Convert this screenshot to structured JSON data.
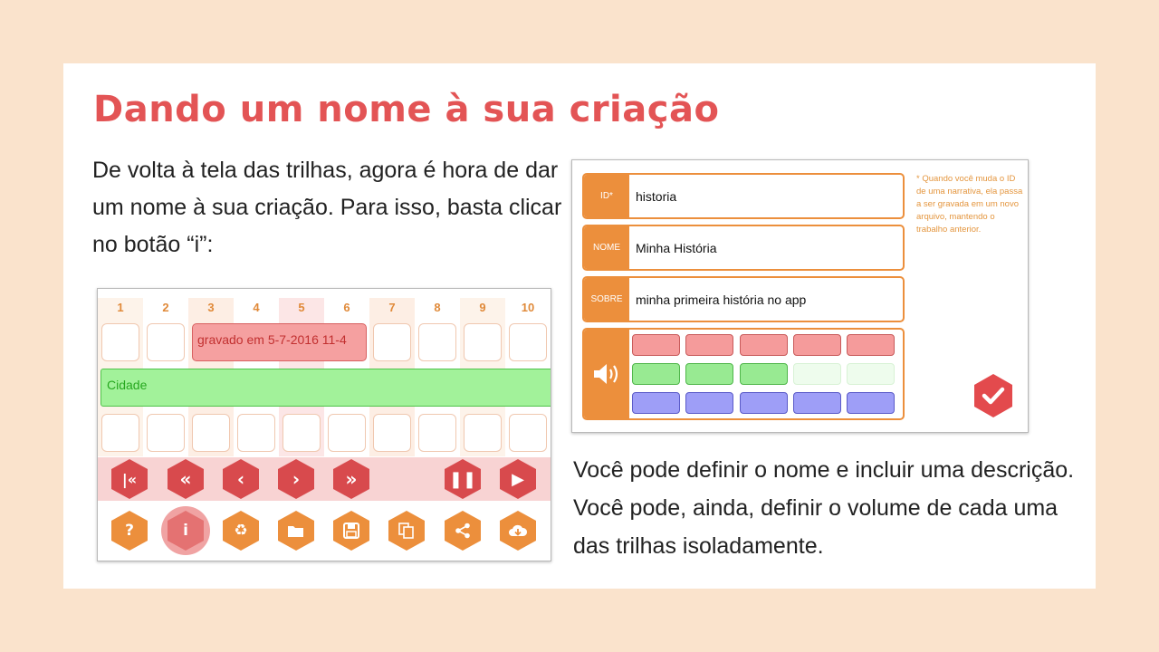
{
  "slide": {
    "title": "Dando um nome à sua criação",
    "paragraph_1": "De volta à tela das trilhas, agora é hora de dar um nome à sua criação. Para isso, basta clicar no botão “i”:",
    "paragraph_2": "Você pode definir o nome e incluir uma descrição. Você pode, ainda, definir o volume de cada uma das trilhas isoladamente."
  },
  "tracks_screen": {
    "column_numbers": [
      "1",
      "2",
      "3",
      "4",
      "5",
      "6",
      "7",
      "8",
      "9",
      "10"
    ],
    "recorded_clip": "gravado em 5-7-2016 11-4",
    "city_clip": "Cidade",
    "nav_icons": [
      "skip-to-start-icon",
      "rewind-icon",
      "previous-icon",
      "next-icon",
      "fast-forward-icon",
      "pause-icon",
      "play-icon"
    ],
    "tool_icons": [
      "help-icon",
      "info-icon",
      "recycle-icon",
      "open-folder-icon",
      "save-icon",
      "copy-icon",
      "share-icon",
      "download-cloud-icon"
    ],
    "colors": {
      "red_button": "#d84a4d",
      "orange_button": "#ec8f3c",
      "highlight": "#f0a3a3"
    }
  },
  "info_screen": {
    "fields": [
      {
        "label": "ID*",
        "value": "historia"
      },
      {
        "label": "NOME",
        "value": "Minha História"
      },
      {
        "label": "SOBRE",
        "value": "minha primeira história no app"
      }
    ],
    "note": "* Quando você muda o ID de uma narrativa, ela passa a ser gravada em um novo arquivo, mantendo o trabalho anterior.",
    "volume_icon": "speaker-volume-icon",
    "confirm_icon": "checkmark-icon",
    "volume_tracks": [
      {
        "color": "red",
        "level_of_5": 5
      },
      {
        "color": "green",
        "level_of_5": 3
      },
      {
        "color": "blue",
        "level_of_5": 5
      }
    ]
  }
}
